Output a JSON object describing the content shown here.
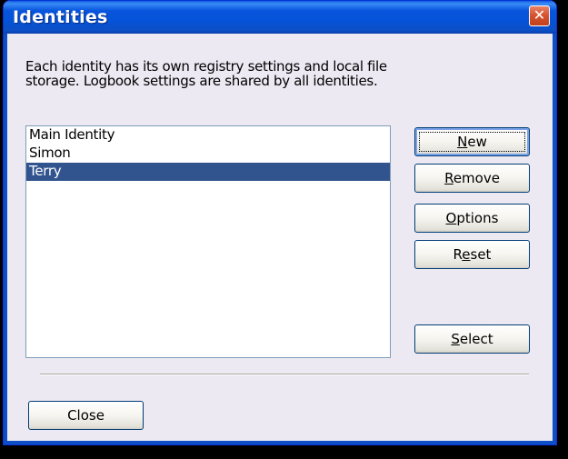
{
  "window": {
    "title": "Identities",
    "close_glyph": "✕"
  },
  "description": "Each identity has its own registry settings and local file storage. Logbook settings are shared by all identities.",
  "identities": {
    "items": [
      {
        "label": "Main Identity",
        "selected": false
      },
      {
        "label": "Simon",
        "selected": false
      },
      {
        "label": "Terry",
        "selected": true
      }
    ]
  },
  "buttons": {
    "new": {
      "pre": "",
      "accel": "N",
      "post": "ew"
    },
    "remove": {
      "pre": "",
      "accel": "R",
      "post": "emove"
    },
    "options": {
      "pre": "",
      "accel": "O",
      "post": "ptions"
    },
    "reset": {
      "pre": "R",
      "accel": "e",
      "post": "set"
    },
    "select": {
      "pre": "",
      "accel": "S",
      "post": "elect"
    },
    "close": "Close"
  },
  "colors": {
    "title_bar": "#0553d8",
    "selection": "#31548f",
    "close_button": "#d8542f"
  }
}
